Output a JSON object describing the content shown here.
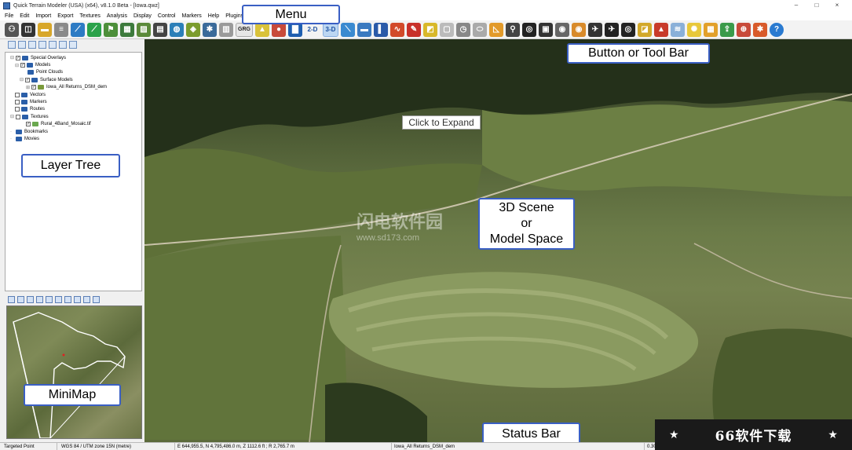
{
  "window": {
    "title": "Quick Terrain Modeler (USA) (x64), v8.1.0 Beta - [Iowa.qwz]",
    "controls": [
      "–",
      "□",
      "×"
    ]
  },
  "menu": {
    "items": [
      "File",
      "Edit",
      "Import",
      "Export",
      "Textures",
      "Analysis",
      "Display",
      "Control",
      "Markers",
      "Help",
      "Plugins"
    ]
  },
  "toolbar": {
    "grg_label": "GRG",
    "two_d_label": "2-D",
    "three_d_label": "3-D"
  },
  "layer_tree": {
    "items": [
      {
        "label": "Special Overlays",
        "expander": "⊟",
        "checked": true
      },
      {
        "label": "Models",
        "expander": "⊟",
        "checked": true
      },
      {
        "label": "Point Clouds",
        "expander": "",
        "checked": false
      },
      {
        "label": "Surface Models",
        "expander": "⊟",
        "checked": true
      },
      {
        "label": "Iowa_All Returns_DSM_dem",
        "expander": "⊞",
        "checked": true
      },
      {
        "label": "Vectors",
        "expander": "",
        "checked": false
      },
      {
        "label": "Markers",
        "expander": "",
        "checked": false
      },
      {
        "label": "Routes",
        "expander": "",
        "checked": false
      },
      {
        "label": "Textures",
        "expander": "⊟",
        "checked": false
      },
      {
        "label": "Rural_4Band_Mosaic.tif",
        "expander": "",
        "checked": true
      },
      {
        "label": "Bookmarks",
        "expander": "",
        "checked": false
      },
      {
        "label": "Movies",
        "expander": "",
        "checked": false
      }
    ]
  },
  "scene": {
    "expand_tip": "Click to Expand"
  },
  "callouts": {
    "menu": "Menu",
    "toolbar": "Button or Tool Bar",
    "layer_tree": "Layer Tree",
    "scene_line1": "3D Scene",
    "scene_line2": "or",
    "scene_line3": "Model Space",
    "minimap": "MiniMap",
    "status_bar": "Status Bar"
  },
  "watermark": {
    "main": "闪电软件园",
    "url": "www.sd173.com"
  },
  "status": {
    "mode": "Targeted Point",
    "projection": "WGS 84 / UTM zone 15N (metre)",
    "coords": "E 644,955.5, N 4,795,486.0 m, Z 1112.6 ft ; R 2,765.7 m",
    "model": "Iowa_All Returns_DSM_dem",
    "zoom": "0.30"
  },
  "badge": {
    "text": "66软件下载",
    "star": "★"
  }
}
